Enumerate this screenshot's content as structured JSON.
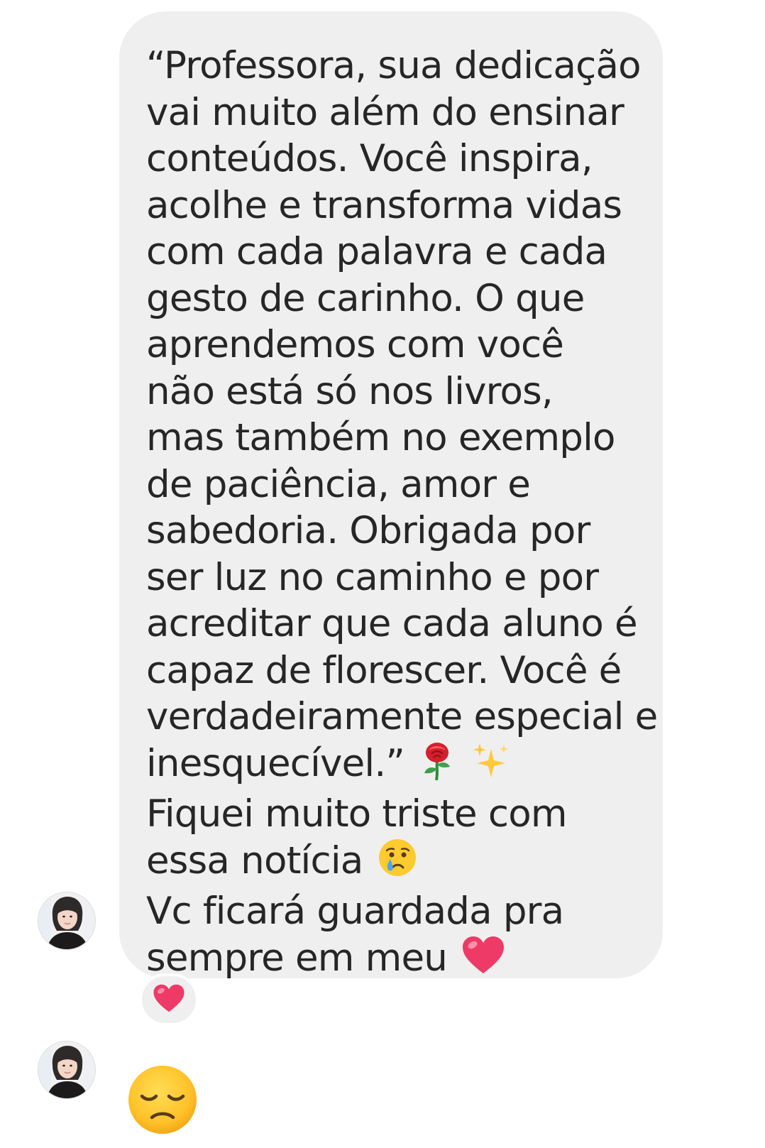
{
  "message": {
    "lines": [
      "“Professora, sua dedicação",
      "vai muito além do ensinar",
      "conteúdos. Você inspira,",
      "acolhe e transforma vidas",
      "com cada palavra e cada",
      "gesto de carinho. O que",
      "aprendemos com você",
      "não está só nos livros,",
      "mas também no exemplo",
      "de paciência, amor e",
      "sabedoria. Obrigada por",
      "ser luz no caminho e por",
      "acreditar que cada aluno é",
      "capaz de florescer. Você é",
      "verdadeiramente especial e",
      "inesquecível.”",
      "Fiquei muito triste com",
      "essa notícia",
      "Vc ficará guardada pra",
      "sempre em meu"
    ],
    "line_emojis": {
      "line16": [
        "rose-emoji",
        "sparkles-emoji"
      ],
      "line18": [
        "crying-face-emoji"
      ],
      "line20": [
        "red-heart-emoji"
      ]
    }
  },
  "reaction": {
    "icon": "heart-reaction-icon"
  },
  "next_message": {
    "icon": "disappointed-face-emoji"
  },
  "colors": {
    "bubble_bg": "#efefef",
    "text": "#262626",
    "heart": "#ee3a66",
    "emoji_yellow": "#ffcb2e"
  }
}
